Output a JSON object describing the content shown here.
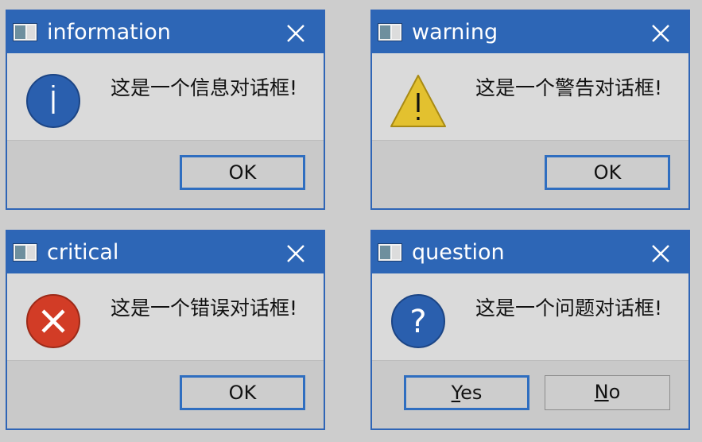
{
  "dialogs": {
    "information": {
      "title": "information",
      "message": "这是一个信息对话框!",
      "icon": "information-icon",
      "ok_label": "OK"
    },
    "warning": {
      "title": "warning",
      "message": "这是一个警告对话框!",
      "icon": "warning-icon",
      "ok_label": "OK"
    },
    "critical": {
      "title": "critical",
      "message": "这是一个错误对话框!",
      "icon": "critical-icon",
      "ok_label": "OK"
    },
    "question": {
      "title": "question",
      "message": "这是一个问题对话框!",
      "icon": "question-icon",
      "yes_label": {
        "mnemonic": "Y",
        "rest": "es"
      },
      "no_label": {
        "mnemonic": "N",
        "rest": "o"
      }
    }
  },
  "colors": {
    "titlebar": "#2d66b6",
    "info_icon": "#2a5fae",
    "warning_icon": "#e3c12f",
    "critical_icon": "#d23c26",
    "question_icon": "#2a5fae"
  }
}
